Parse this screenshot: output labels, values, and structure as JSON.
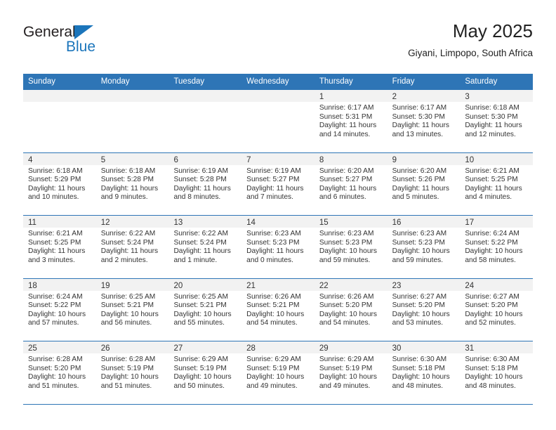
{
  "logo": {
    "word_one": "General",
    "word_two": "Blue",
    "triangle_icon": "blue-triangle-icon",
    "accent_color": "#1b75bb"
  },
  "header": {
    "title": "May 2025",
    "subtitle": "Giyani, Limpopo, South Africa"
  },
  "theme": {
    "header_row_color": "#2e75b6",
    "daynum_bg": "#f2f2f2",
    "daynum_bg_shaded": "#ebebeb",
    "text_color": "#333333"
  },
  "weekdays": [
    "Sunday",
    "Monday",
    "Tuesday",
    "Wednesday",
    "Thursday",
    "Friday",
    "Saturday"
  ],
  "weeks": [
    [
      {
        "day": "",
        "sunrise": "",
        "sunset": "",
        "daylight": ""
      },
      {
        "day": "",
        "sunrise": "",
        "sunset": "",
        "daylight": ""
      },
      {
        "day": "",
        "sunrise": "",
        "sunset": "",
        "daylight": ""
      },
      {
        "day": "",
        "sunrise": "",
        "sunset": "",
        "daylight": ""
      },
      {
        "day": "1",
        "sunrise": "Sunrise: 6:17 AM",
        "sunset": "Sunset: 5:31 PM",
        "daylight": "Daylight: 11 hours and 14 minutes."
      },
      {
        "day": "2",
        "sunrise": "Sunrise: 6:17 AM",
        "sunset": "Sunset: 5:30 PM",
        "daylight": "Daylight: 11 hours and 13 minutes."
      },
      {
        "day": "3",
        "sunrise": "Sunrise: 6:18 AM",
        "sunset": "Sunset: 5:30 PM",
        "daylight": "Daylight: 11 hours and 12 minutes."
      }
    ],
    [
      {
        "day": "4",
        "sunrise": "Sunrise: 6:18 AM",
        "sunset": "Sunset: 5:29 PM",
        "daylight": "Daylight: 11 hours and 10 minutes."
      },
      {
        "day": "5",
        "sunrise": "Sunrise: 6:18 AM",
        "sunset": "Sunset: 5:28 PM",
        "daylight": "Daylight: 11 hours and 9 minutes."
      },
      {
        "day": "6",
        "sunrise": "Sunrise: 6:19 AM",
        "sunset": "Sunset: 5:28 PM",
        "daylight": "Daylight: 11 hours and 8 minutes."
      },
      {
        "day": "7",
        "sunrise": "Sunrise: 6:19 AM",
        "sunset": "Sunset: 5:27 PM",
        "daylight": "Daylight: 11 hours and 7 minutes."
      },
      {
        "day": "8",
        "sunrise": "Sunrise: 6:20 AM",
        "sunset": "Sunset: 5:27 PM",
        "daylight": "Daylight: 11 hours and 6 minutes."
      },
      {
        "day": "9",
        "sunrise": "Sunrise: 6:20 AM",
        "sunset": "Sunset: 5:26 PM",
        "daylight": "Daylight: 11 hours and 5 minutes."
      },
      {
        "day": "10",
        "sunrise": "Sunrise: 6:21 AM",
        "sunset": "Sunset: 5:25 PM",
        "daylight": "Daylight: 11 hours and 4 minutes."
      }
    ],
    [
      {
        "day": "11",
        "sunrise": "Sunrise: 6:21 AM",
        "sunset": "Sunset: 5:25 PM",
        "daylight": "Daylight: 11 hours and 3 minutes."
      },
      {
        "day": "12",
        "sunrise": "Sunrise: 6:22 AM",
        "sunset": "Sunset: 5:24 PM",
        "daylight": "Daylight: 11 hours and 2 minutes."
      },
      {
        "day": "13",
        "sunrise": "Sunrise: 6:22 AM",
        "sunset": "Sunset: 5:24 PM",
        "daylight": "Daylight: 11 hours and 1 minute."
      },
      {
        "day": "14",
        "sunrise": "Sunrise: 6:23 AM",
        "sunset": "Sunset: 5:23 PM",
        "daylight": "Daylight: 11 hours and 0 minutes."
      },
      {
        "day": "15",
        "sunrise": "Sunrise: 6:23 AM",
        "sunset": "Sunset: 5:23 PM",
        "daylight": "Daylight: 10 hours and 59 minutes."
      },
      {
        "day": "16",
        "sunrise": "Sunrise: 6:23 AM",
        "sunset": "Sunset: 5:23 PM",
        "daylight": "Daylight: 10 hours and 59 minutes."
      },
      {
        "day": "17",
        "sunrise": "Sunrise: 6:24 AM",
        "sunset": "Sunset: 5:22 PM",
        "daylight": "Daylight: 10 hours and 58 minutes."
      }
    ],
    [
      {
        "day": "18",
        "sunrise": "Sunrise: 6:24 AM",
        "sunset": "Sunset: 5:22 PM",
        "daylight": "Daylight: 10 hours and 57 minutes."
      },
      {
        "day": "19",
        "sunrise": "Sunrise: 6:25 AM",
        "sunset": "Sunset: 5:21 PM",
        "daylight": "Daylight: 10 hours and 56 minutes."
      },
      {
        "day": "20",
        "sunrise": "Sunrise: 6:25 AM",
        "sunset": "Sunset: 5:21 PM",
        "daylight": "Daylight: 10 hours and 55 minutes."
      },
      {
        "day": "21",
        "sunrise": "Sunrise: 6:26 AM",
        "sunset": "Sunset: 5:21 PM",
        "daylight": "Daylight: 10 hours and 54 minutes."
      },
      {
        "day": "22",
        "sunrise": "Sunrise: 6:26 AM",
        "sunset": "Sunset: 5:20 PM",
        "daylight": "Daylight: 10 hours and 54 minutes."
      },
      {
        "day": "23",
        "sunrise": "Sunrise: 6:27 AM",
        "sunset": "Sunset: 5:20 PM",
        "daylight": "Daylight: 10 hours and 53 minutes."
      },
      {
        "day": "24",
        "sunrise": "Sunrise: 6:27 AM",
        "sunset": "Sunset: 5:20 PM",
        "daylight": "Daylight: 10 hours and 52 minutes."
      }
    ],
    [
      {
        "day": "25",
        "sunrise": "Sunrise: 6:28 AM",
        "sunset": "Sunset: 5:20 PM",
        "daylight": "Daylight: 10 hours and 51 minutes."
      },
      {
        "day": "26",
        "sunrise": "Sunrise: 6:28 AM",
        "sunset": "Sunset: 5:19 PM",
        "daylight": "Daylight: 10 hours and 51 minutes."
      },
      {
        "day": "27",
        "sunrise": "Sunrise: 6:29 AM",
        "sunset": "Sunset: 5:19 PM",
        "daylight": "Daylight: 10 hours and 50 minutes."
      },
      {
        "day": "28",
        "sunrise": "Sunrise: 6:29 AM",
        "sunset": "Sunset: 5:19 PM",
        "daylight": "Daylight: 10 hours and 49 minutes."
      },
      {
        "day": "29",
        "sunrise": "Sunrise: 6:29 AM",
        "sunset": "Sunset: 5:19 PM",
        "daylight": "Daylight: 10 hours and 49 minutes."
      },
      {
        "day": "30",
        "sunrise": "Sunrise: 6:30 AM",
        "sunset": "Sunset: 5:18 PM",
        "daylight": "Daylight: 10 hours and 48 minutes."
      },
      {
        "day": "31",
        "sunrise": "Sunrise: 6:30 AM",
        "sunset": "Sunset: 5:18 PM",
        "daylight": "Daylight: 10 hours and 48 minutes."
      }
    ]
  ]
}
